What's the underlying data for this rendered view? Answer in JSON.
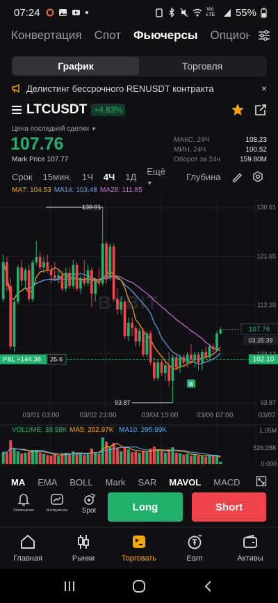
{
  "status_bar": {
    "time": "07:24",
    "battery": "55%",
    "network": "Vo) LTE"
  },
  "top_tabs": [
    "Конвертация",
    "Спот",
    "Фьючерсы",
    "Опцион"
  ],
  "active_top_tab": 2,
  "segment": {
    "chart": "График",
    "trade": "Торговля"
  },
  "notice": {
    "text": "Делистинг  бессрочного RENUSDT контракта",
    "close": "×"
  },
  "pair": {
    "symbol": "LTCUSDT",
    "change": "+4.63%"
  },
  "price": {
    "last_label": "Цена последней сделки",
    "last": "107.76",
    "mark": "Mark Price 107.77"
  },
  "stats": [
    {
      "label": "МАКС, 24Ч",
      "value": "108.23"
    },
    {
      "label": "МИН, 24Ч",
      "value": "100.52"
    },
    {
      "label": "Оборот за 24ч",
      "value": "159.80M"
    }
  ],
  "timeframes": [
    "Срок",
    "15мин.",
    "1Ч",
    "4Ч",
    "1Д",
    "Ещё",
    "Глубина"
  ],
  "active_timeframe": 3,
  "ma_legend": {
    "ma7": "MA7: 104.53",
    "ma14": "MA14: 103.48",
    "ma28": "MA28: 111.85"
  },
  "volume_legend": {
    "vol": "VOLUME: 38.98K",
    "ma5": "MA5: 202.97K",
    "ma10": "MA10: 295.99K"
  },
  "chart_labels": {
    "high_marker": "130.91",
    "low_marker": "93.87",
    "price_tag": "107.76",
    "countdown": "03:35:39",
    "pnl": "P&L +144.38",
    "pnl_qty": "25.6",
    "pnl_price": "102.10",
    "buy_marker": "B",
    "watermark": "BYBIT"
  },
  "indicator_tabs": [
    "MA",
    "EMA",
    "BOLL",
    "Mark",
    "SAR",
    "MAVOL",
    "MACD"
  ],
  "active_indicators": [
    "MA",
    "MAVOL"
  ],
  "action_bar": {
    "alerts": "Оповещения",
    "tools": "Инструменты",
    "spot": "Spot",
    "long": "Long",
    "short": "Short"
  },
  "bottom_nav": [
    "Главная",
    "Рынки",
    "Торговать",
    "Earn",
    "Активы"
  ],
  "active_bottom_nav": 2,
  "colors": {
    "green": "#20b26c",
    "red": "#ef454a",
    "accent": "#f7a600",
    "ma7": "#f7a600",
    "ma14": "#5aa9e6",
    "ma28": "#c86dd7"
  },
  "chart_data": {
    "type": "candlestick",
    "x_tick_labels": [
      "03/01 03:00",
      "03/02 23:00",
      "03/04 15:00",
      "03/06 07:00",
      "03/07"
    ],
    "y_tick_labels": [
      "130.91",
      "121.65",
      "112.39",
      "103.13",
      "93.87"
    ],
    "ylim": [
      93.87,
      130.91
    ],
    "volume_axis_labels": [
      "1.05M",
      "526.28K",
      "0.000"
    ],
    "candles": [
      [
        113.5,
        120.5,
        122.0,
        113.0
      ],
      [
        120.5,
        116.0,
        121.5,
        115.0
      ],
      [
        116.0,
        104.5,
        117.5,
        104.0
      ],
      [
        104.5,
        113.0,
        113.5,
        103.5
      ],
      [
        113.0,
        119.5,
        120.0,
        112.5
      ],
      [
        119.5,
        117.0,
        121.0,
        116.0
      ],
      [
        117.0,
        119.0,
        119.5,
        115.5
      ],
      [
        119.0,
        113.5,
        120.0,
        113.0
      ],
      [
        113.5,
        120.5,
        121.0,
        113.0
      ],
      [
        120.5,
        121.5,
        124.5,
        120.0
      ],
      [
        121.5,
        119.5,
        122.5,
        119.0
      ],
      [
        119.5,
        120.5,
        121.5,
        118.5
      ],
      [
        120.5,
        119.0,
        122.0,
        118.5
      ],
      [
        119.0,
        118.0,
        120.0,
        116.5
      ],
      [
        118.0,
        117.5,
        120.5,
        117.0
      ],
      [
        117.5,
        118.0,
        119.0,
        116.5
      ],
      [
        118.0,
        115.5,
        119.0,
        115.0
      ],
      [
        115.5,
        118.5,
        119.5,
        115.0
      ],
      [
        118.5,
        116.0,
        119.5,
        115.5
      ],
      [
        116.0,
        120.0,
        121.0,
        115.5
      ],
      [
        120.0,
        115.5,
        120.5,
        115.0
      ],
      [
        115.5,
        117.5,
        118.0,
        114.5
      ],
      [
        117.5,
        116.5,
        121.0,
        116.0
      ],
      [
        116.5,
        119.0,
        120.0,
        116.0
      ],
      [
        119.0,
        114.5,
        119.5,
        112.0
      ],
      [
        114.5,
        117.0,
        117.5,
        113.0
      ],
      [
        117.0,
        116.5,
        119.5,
        116.0
      ],
      [
        116.5,
        124.0,
        130.91,
        116.0
      ],
      [
        124.0,
        117.5,
        124.5,
        116.5
      ],
      [
        117.5,
        123.5,
        124.0,
        117.0
      ],
      [
        123.5,
        113.5,
        124.0,
        113.0
      ],
      [
        113.5,
        111.5,
        115.5,
        110.5
      ],
      [
        111.5,
        113.0,
        114.0,
        110.5
      ],
      [
        113.0,
        106.5,
        113.5,
        106.0
      ],
      [
        106.5,
        109.0,
        110.0,
        105.5
      ],
      [
        109.0,
        108.0,
        110.0,
        106.5
      ],
      [
        108.0,
        105.5,
        108.5,
        104.5
      ],
      [
        105.5,
        107.5,
        108.0,
        104.5
      ],
      [
        107.5,
        103.0,
        108.0,
        102.5
      ],
      [
        103.0,
        107.0,
        107.5,
        102.5
      ],
      [
        107.0,
        101.5,
        107.5,
        101.0
      ],
      [
        101.5,
        98.5,
        102.5,
        98.0
      ],
      [
        98.5,
        101.5,
        102.0,
        98.0
      ],
      [
        101.5,
        99.5,
        102.0,
        99.0
      ],
      [
        99.5,
        101.0,
        101.5,
        98.0
      ],
      [
        101.0,
        98.0,
        103.5,
        97.0
      ],
      [
        98.0,
        102.5,
        103.0,
        93.87
      ],
      [
        102.5,
        100.5,
        103.0,
        100.0
      ],
      [
        100.5,
        102.5,
        103.0,
        99.5
      ],
      [
        102.5,
        101.5,
        103.0,
        101.0
      ],
      [
        101.5,
        103.0,
        103.5,
        100.5
      ],
      [
        103.0,
        102.0,
        105.0,
        101.5
      ],
      [
        102.0,
        103.0,
        103.5,
        100.5
      ],
      [
        103.0,
        101.5,
        103.5,
        100.0
      ],
      [
        101.5,
        103.5,
        104.0,
        100.0
      ],
      [
        103.5,
        102.5,
        104.5,
        102.0
      ],
      [
        102.5,
        104.5,
        105.0,
        102.0
      ],
      [
        104.5,
        104.0,
        105.0,
        103.0
      ],
      [
        104.0,
        107.0,
        107.5,
        103.5
      ],
      [
        107.0,
        107.76,
        108.2,
        106.8
      ]
    ],
    "volumes": [
      0.42,
      0.4,
      0.85,
      0.55,
      0.45,
      0.38,
      0.4,
      0.42,
      0.48,
      0.5,
      0.4,
      0.35,
      0.32,
      0.3,
      0.34,
      0.28,
      0.36,
      0.4,
      0.38,
      0.45,
      0.4,
      0.35,
      0.33,
      0.38,
      0.55,
      0.42,
      0.36,
      0.95,
      0.8,
      0.62,
      0.75,
      0.58,
      0.45,
      0.6,
      0.52,
      0.42,
      0.44,
      0.4,
      0.48,
      0.42,
      0.55,
      0.62,
      0.48,
      0.45,
      0.4,
      0.52,
      0.6,
      0.4,
      0.38,
      0.34,
      0.36,
      0.3,
      0.32,
      0.3,
      0.28,
      0.26,
      0.3,
      0.28,
      0.3,
      0.08
    ]
  }
}
